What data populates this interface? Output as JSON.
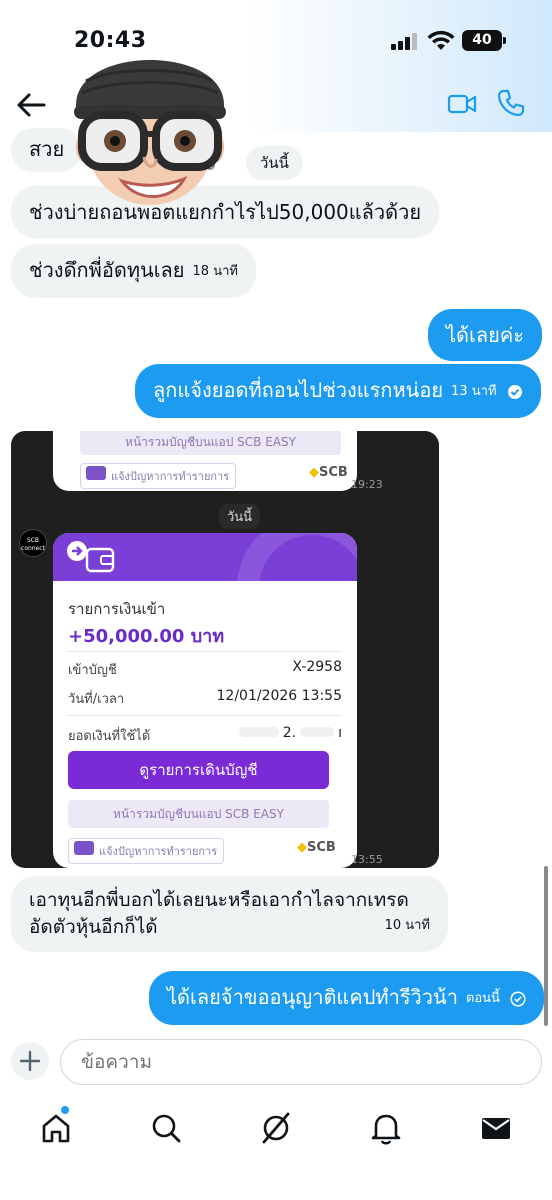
{
  "status": {
    "time": "20:43",
    "battery": "40"
  },
  "header": {
    "back_icon": "arrow-left-icon",
    "video_icon": "video-icon",
    "phone_icon": "phone-icon"
  },
  "chat": {
    "date_chip": "วันนี้",
    "messages": [
      {
        "dir": "in",
        "text": "สวย"
      },
      {
        "dir": "in",
        "text": "ช่วงบ่ายถอนพอตแยกกำไรไป50,000แล้วด้วย"
      },
      {
        "dir": "in",
        "text": "ช่วงดึกพี่อัดทุนเลย",
        "time": "18 นาที"
      },
      {
        "dir": "out",
        "text": "ได้เลยค่ะ"
      },
      {
        "dir": "out",
        "text": "ลูกแจ้งยอดที่ถอนไปช่วงแรกหน่อย",
        "time": "13 นาที"
      },
      {
        "dir": "in",
        "text": "เอาทุนอีกพี่บอกได้เลยนะหรือเอากำไลจากเทรด",
        "text2": "อัดตัวหุ้นอีกก็ได้",
        "time": "10 นาที"
      },
      {
        "dir": "out",
        "text": "ได้เลยจ้าขออนุญาติแคปทำรีวิวน้า",
        "time": "ตอนนี้"
      }
    ]
  },
  "image_message": {
    "top_pill": "หน้ารวมบัญชีบนแอป SCB EASY",
    "report_label": "แจ้งปัญหาการทำรายการ",
    "brand": "SCB",
    "time_top": "19:23",
    "date_chip": "วันนี้",
    "logo_text": "SCB connect",
    "card": {
      "title": "รายการเงินเข้า",
      "amount": "+50,000.00 บาท",
      "account_label": "เข้าบัญชี",
      "account_value": "X-2958",
      "datetime_label": "วันที่/เวลา",
      "datetime_value": "12/01/2026 13:55",
      "balance_label": "ยอดเงินที่ใช้ได้",
      "balance_value": "2.",
      "balance_suffix": "ı",
      "button": "ดูรายการเดินบัญชี",
      "pill": "หน้ารวมบัญชีบนแอป SCB EASY",
      "report_label": "แจ้งปัญหาการทำรายการ",
      "brand": "SCB"
    },
    "time_bottom": "13:55"
  },
  "composer": {
    "placeholder": "ข้อความ"
  },
  "nav": [
    "home-icon",
    "search-icon",
    "grok-icon",
    "bell-icon",
    "mail-icon"
  ]
}
